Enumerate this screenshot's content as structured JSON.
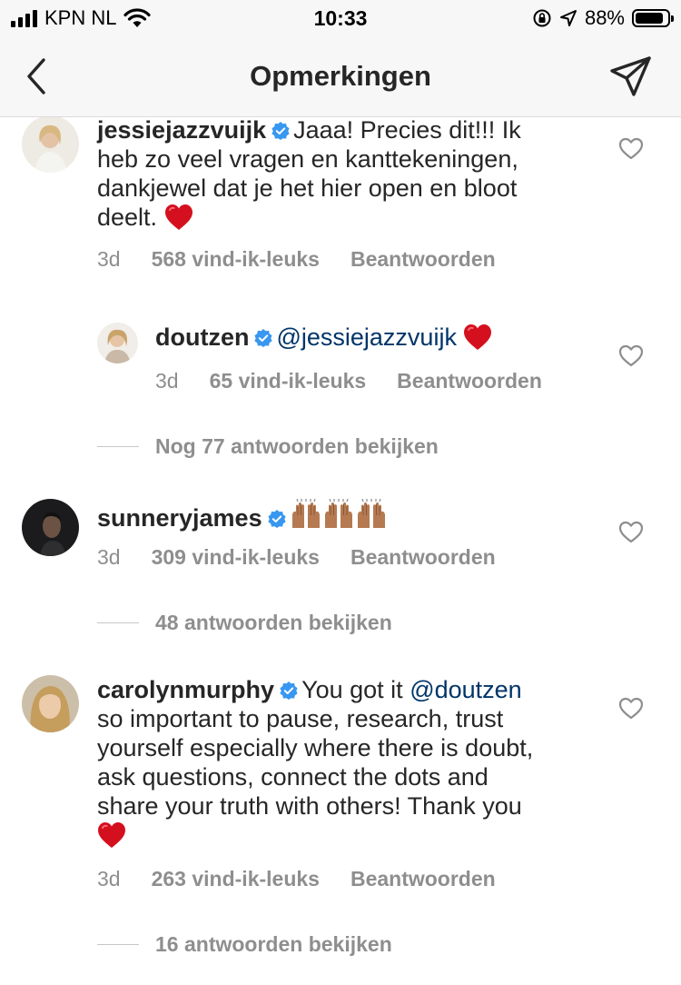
{
  "status_bar": {
    "carrier": "KPN NL",
    "time": "10:33",
    "battery": "88%",
    "battery_level": 0.88
  },
  "nav": {
    "title": "Opmerkingen",
    "back_icon": "chevron-left-icon",
    "send_icon": "paper-plane-icon"
  },
  "colors": {
    "text": "#262626",
    "secondary": "#8e8e8e",
    "mention": "#003569",
    "verified": "#3897f0",
    "heart": "#ed4956"
  },
  "comments": [
    {
      "username": "jessiejazzvuijk",
      "verified": true,
      "line1": "Jaaa! Precies dit!!! Ik",
      "line2": "heb zo veel vragen en kanttekeningen,",
      "line3": "dankjewel dat je het hier open en bloot",
      "line4": "deelt.",
      "emoji": "red-heart",
      "time": "3d",
      "likes": "568 vind-ik-leuks",
      "reply": "Beantwoorden"
    },
    {
      "username": "doutzen",
      "verified": true,
      "mention": "@jessiejazzvuijk",
      "emoji": "red-heart",
      "time": "3d",
      "likes": "65 vind-ik-leuks",
      "reply": "Beantwoorden"
    },
    {
      "view_replies": "Nog 77 antwoorden bekijken"
    },
    {
      "username": "sunneryjames",
      "verified": true,
      "emoji": "raised-hands x3",
      "time": "3d",
      "likes": "309 vind-ik-leuks",
      "reply": "Beantwoorden",
      "view_replies": "48 antwoorden bekijken"
    },
    {
      "username": "carolynmurphy",
      "verified": true,
      "line1": "You got it",
      "mention": "@doutzen",
      "line2": "so important to pause, research, trust",
      "line3": "yourself especially where there is doubt,",
      "line4": "ask questions, connect the dots and",
      "line5": "share your truth with others! Thank you",
      "emoji": "red-heart",
      "time": "3d",
      "likes": "263 vind-ik-leuks",
      "reply": "Beantwoorden",
      "view_replies": "16 antwoorden bekijken"
    }
  ]
}
